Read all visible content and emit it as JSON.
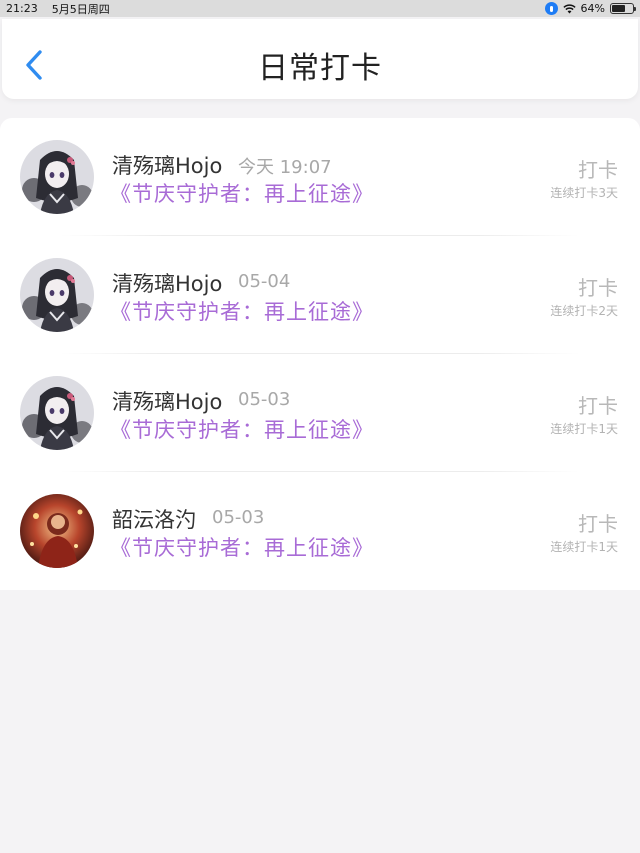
{
  "status_bar": {
    "time": "21:23",
    "date": "5月5日周四",
    "battery": "64%",
    "battery_level": 0.64
  },
  "header": {
    "title": "日常打卡",
    "accent_color": "#2f8cf0"
  },
  "entries": [
    {
      "username": "清殇璃Hojo",
      "date": "今天 19:07",
      "event": "《节庆守护者：再上征途》",
      "action": "打卡",
      "streak": "连续打卡3天",
      "avatar": "anime-girl-avatar"
    },
    {
      "username": "清殇璃Hojo",
      "date": "05-04",
      "event": "《节庆守护者：再上征途》",
      "action": "打卡",
      "streak": "连续打卡2天",
      "avatar": "anime-girl-avatar"
    },
    {
      "username": "清殇璃Hojo",
      "date": "05-03",
      "event": "《节庆守护者：再上征途》",
      "action": "打卡",
      "streak": "连续打卡1天",
      "avatar": "anime-girl-avatar"
    },
    {
      "username": "韶沄洛汋",
      "date": "05-03",
      "event": "《节庆守护者：再上征途》",
      "action": "打卡",
      "streak": "连续打卡1天",
      "avatar": "festive-red-avatar"
    }
  ]
}
